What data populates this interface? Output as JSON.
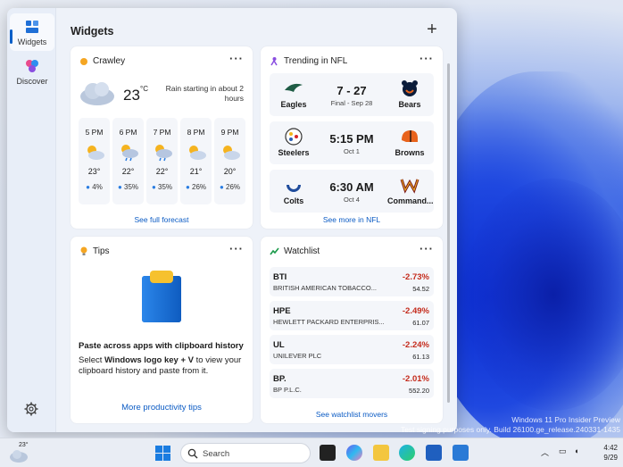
{
  "widgets_panel": {
    "title": "Widgets",
    "add_label": "+",
    "rail": [
      {
        "label": "Widgets",
        "icon": "widgets-icon",
        "active": true
      },
      {
        "label": "Discover",
        "icon": "discover-icon",
        "active": false
      }
    ]
  },
  "weather": {
    "location": "Crawley",
    "temperature": "23",
    "unit": "°C",
    "description": "Rain starting in about 2 hours",
    "hours": [
      {
        "time": "5 PM",
        "temp": "23°",
        "precip": "4%"
      },
      {
        "time": "6 PM",
        "temp": "22°",
        "precip": "35%"
      },
      {
        "time": "7 PM",
        "temp": "22°",
        "precip": "35%"
      },
      {
        "time": "8 PM",
        "temp": "21°",
        "precip": "26%"
      },
      {
        "time": "9 PM",
        "temp": "20°",
        "precip": "26%"
      }
    ],
    "link": "See full forecast"
  },
  "nfl": {
    "title": "Trending in NFL",
    "games": [
      {
        "home": "Eagles",
        "away": "Bears",
        "score": "7 - 27",
        "sub": "Final - Sep 28"
      },
      {
        "home": "Steelers",
        "away": "Browns",
        "score": "5:15 PM",
        "sub": "Oct 1"
      },
      {
        "home": "Colts",
        "away": "Command...",
        "score": "6:30 AM",
        "sub": "Oct 4"
      }
    ],
    "link": "See more in NFL"
  },
  "tips": {
    "title": "Tips",
    "heading": "Paste across apps with clipboard history",
    "body_pre": "Select ",
    "body_bold": "Windows logo key + V",
    "body_post": " to view your clipboard history and paste from it.",
    "link": "More productivity tips"
  },
  "watchlist": {
    "title": "Watchlist",
    "stocks": [
      {
        "symbol": "BTI",
        "name": "BRITISH AMERICAN TOBACCO...",
        "change": "-2.73%",
        "price": "54.52"
      },
      {
        "symbol": "HPE",
        "name": "HEWLETT PACKARD ENTERPRIS...",
        "change": "-2.49%",
        "price": "61.07"
      },
      {
        "symbol": "UL",
        "name": "UNILEVER PLC",
        "change": "-2.24%",
        "price": "61.13"
      },
      {
        "symbol": "BP.",
        "name": "BP P.L.C.",
        "change": "-2.01%",
        "price": "552.20"
      }
    ],
    "link": "See watchlist movers"
  },
  "watermark": {
    "line1": "Windows 11 Pro Insider Preview",
    "line2": "Test signing purposes only. Build 26100.ge_release.240331-1435"
  },
  "taskbar": {
    "weather_temp": "23°",
    "search_placeholder": "Search",
    "time": "4:42",
    "date": "9/29"
  },
  "colors": {
    "accent": "#0b5bc4",
    "negative": "#c42b1c"
  }
}
